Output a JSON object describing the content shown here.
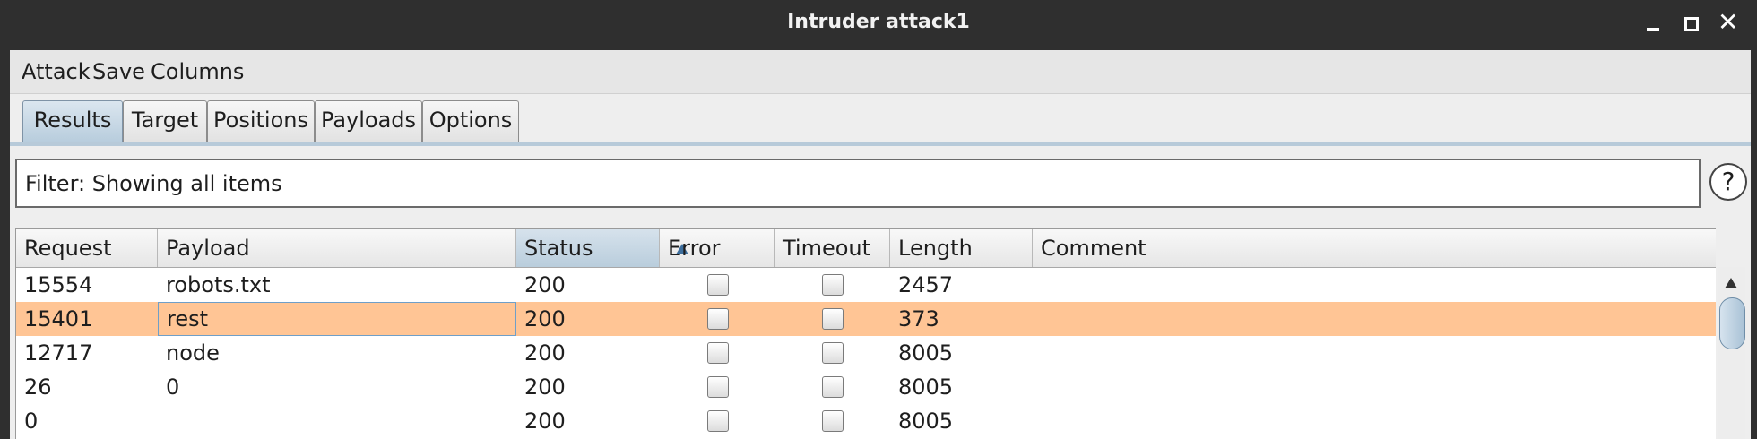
{
  "window": {
    "title": "Intruder attack1"
  },
  "menu": [
    "Attack",
    "Save",
    "Columns"
  ],
  "tabs": [
    "Results",
    "Target",
    "Positions",
    "Payloads",
    "Options"
  ],
  "active_tab": "Results",
  "filter": {
    "text": "Filter: Showing all items",
    "help_label": "?"
  },
  "table": {
    "columns": [
      "Request",
      "Payload",
      "Status",
      "Error",
      "Timeout",
      "Length",
      "Comment"
    ],
    "sorted_column": "Status",
    "sort_direction": "ascending",
    "rows": [
      {
        "request": "15554",
        "payload": "robots.txt",
        "status": "200",
        "error": false,
        "timeout": false,
        "length": "2457",
        "comment": ""
      },
      {
        "request": "15401",
        "payload": "rest",
        "status": "200",
        "error": false,
        "timeout": false,
        "length": "373",
        "comment": "",
        "selected": true
      },
      {
        "request": "12717",
        "payload": "node",
        "status": "200",
        "error": false,
        "timeout": false,
        "length": "8005",
        "comment": ""
      },
      {
        "request": "26",
        "payload": "0",
        "status": "200",
        "error": false,
        "timeout": false,
        "length": "8005",
        "comment": ""
      },
      {
        "request": "0",
        "payload": "",
        "status": "200",
        "error": false,
        "timeout": false,
        "length": "8005",
        "comment": ""
      }
    ]
  },
  "colors": {
    "selected_row": "#ffc595",
    "title_bar": "#2f2f2f",
    "sorted_header": "#b9cddc"
  }
}
